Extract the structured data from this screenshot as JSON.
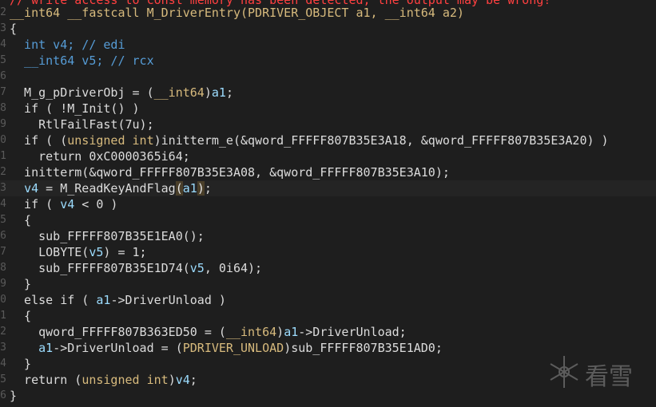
{
  "header_comment": "// write access to const memory has been detected, the output may be wrong!",
  "line_numbers": [
    "2",
    "3",
    "4",
    "5",
    "6",
    "7",
    "8",
    "9",
    "0",
    "1",
    "2",
    "3",
    "4",
    "5",
    "6",
    "7",
    "8",
    "9",
    "0",
    "1",
    "2",
    "3",
    "4",
    "5",
    "6"
  ],
  "lines": [
    {
      "tokens": [
        {
          "t": "__int64 __fastcall M_DriverEntry(PDRIVER_OBJECT a1, __int64 a2)",
          "c": "ty"
        }
      ]
    },
    {
      "tokens": [
        {
          "t": "{",
          "c": "fn"
        }
      ]
    },
    {
      "tokens": [
        {
          "t": "  int v4; // edi",
          "c": "kw"
        }
      ]
    },
    {
      "tokens": [
        {
          "t": "  __int64 v5; // rcx",
          "c": "kw"
        }
      ]
    },
    {
      "tokens": [
        {
          "t": "",
          "c": "fn"
        }
      ]
    },
    {
      "tokens": [
        {
          "t": "  M_g_pDriverObj = (",
          "c": "fn"
        },
        {
          "t": "__int64",
          "c": "ty"
        },
        {
          "t": ")",
          "c": "fn"
        },
        {
          "t": "a1",
          "c": "var"
        },
        {
          "t": ";",
          "c": "fn"
        }
      ]
    },
    {
      "tokens": [
        {
          "t": "  if ( !M_Init() )",
          "c": "fn"
        }
      ]
    },
    {
      "tokens": [
        {
          "t": "    RtlFailFast(7u);",
          "c": "fn"
        }
      ]
    },
    {
      "tokens": [
        {
          "t": "  if ( (",
          "c": "fn"
        },
        {
          "t": "unsigned int",
          "c": "ty"
        },
        {
          "t": ")initterm_e(&qword_FFFFF807B35E3A18, &qword_FFFFF807B35E3A20) )",
          "c": "fn"
        }
      ]
    },
    {
      "tokens": [
        {
          "t": "    return 0xC0000365i64;",
          "c": "fn"
        }
      ]
    },
    {
      "tokens": [
        {
          "t": "  initterm(&qword_FFFFF807B35E3A08, &qword_FFFFF807B35E3A10);",
          "c": "fn"
        }
      ]
    },
    {
      "tokens": [
        {
          "t": "  ",
          "c": "fn"
        },
        {
          "t": "v4",
          "c": "var"
        },
        {
          "t": " = M_ReadKeyAndFlag",
          "c": "fn"
        },
        {
          "t": "(",
          "c": "hl"
        },
        {
          "t": "a1",
          "c": "var"
        },
        {
          "t": ")",
          "c": "hl"
        },
        {
          "t": ";",
          "c": "fn"
        }
      ],
      "current": true
    },
    {
      "tokens": [
        {
          "t": "  if ( ",
          "c": "fn"
        },
        {
          "t": "v4",
          "c": "var"
        },
        {
          "t": " < 0 )",
          "c": "fn"
        }
      ]
    },
    {
      "tokens": [
        {
          "t": "  {",
          "c": "fn"
        }
      ]
    },
    {
      "tokens": [
        {
          "t": "    sub_FFFFF807B35E1EA0();",
          "c": "fn"
        }
      ]
    },
    {
      "tokens": [
        {
          "t": "    LOBYTE(",
          "c": "fn"
        },
        {
          "t": "v5",
          "c": "var"
        },
        {
          "t": ") = 1;",
          "c": "fn"
        }
      ]
    },
    {
      "tokens": [
        {
          "t": "    sub_FFFFF807B35E1D74(",
          "c": "fn"
        },
        {
          "t": "v5",
          "c": "var"
        },
        {
          "t": ", 0i64);",
          "c": "fn"
        }
      ]
    },
    {
      "tokens": [
        {
          "t": "  }",
          "c": "fn"
        }
      ]
    },
    {
      "tokens": [
        {
          "t": "  else if ( ",
          "c": "fn"
        },
        {
          "t": "a1",
          "c": "var"
        },
        {
          "t": "->DriverUnload )",
          "c": "fn"
        }
      ]
    },
    {
      "tokens": [
        {
          "t": "  {",
          "c": "fn"
        }
      ]
    },
    {
      "tokens": [
        {
          "t": "    qword_FFFFF807B363ED50 = (",
          "c": "fn"
        },
        {
          "t": "__int64",
          "c": "ty"
        },
        {
          "t": ")",
          "c": "fn"
        },
        {
          "t": "a1",
          "c": "var"
        },
        {
          "t": "->DriverUnload;",
          "c": "fn"
        }
      ]
    },
    {
      "tokens": [
        {
          "t": "    ",
          "c": "fn"
        },
        {
          "t": "a1",
          "c": "var"
        },
        {
          "t": "->DriverUnload = (",
          "c": "fn"
        },
        {
          "t": "PDRIVER_UNLOAD",
          "c": "ty"
        },
        {
          "t": ")sub_FFFFF807B35E1AD0;",
          "c": "fn"
        }
      ]
    },
    {
      "tokens": [
        {
          "t": "  }",
          "c": "fn"
        }
      ]
    },
    {
      "tokens": [
        {
          "t": "  return (",
          "c": "fn"
        },
        {
          "t": "unsigned int",
          "c": "ty"
        },
        {
          "t": ")",
          "c": "fn"
        },
        {
          "t": "v4",
          "c": "var"
        },
        {
          "t": ";",
          "c": "fn"
        }
      ]
    },
    {
      "tokens": [
        {
          "t": "}",
          "c": "fn"
        }
      ]
    }
  ],
  "watermark": {
    "icon": "snowflake-icon",
    "text": "看雪"
  },
  "colors": {
    "background": "#1e1e1e",
    "keyword": "#569cd6",
    "type": "#d7ba7d",
    "variable": "#9cdcfe",
    "warning": "#ff4040",
    "bracket_highlight": "#4a3f2a"
  }
}
